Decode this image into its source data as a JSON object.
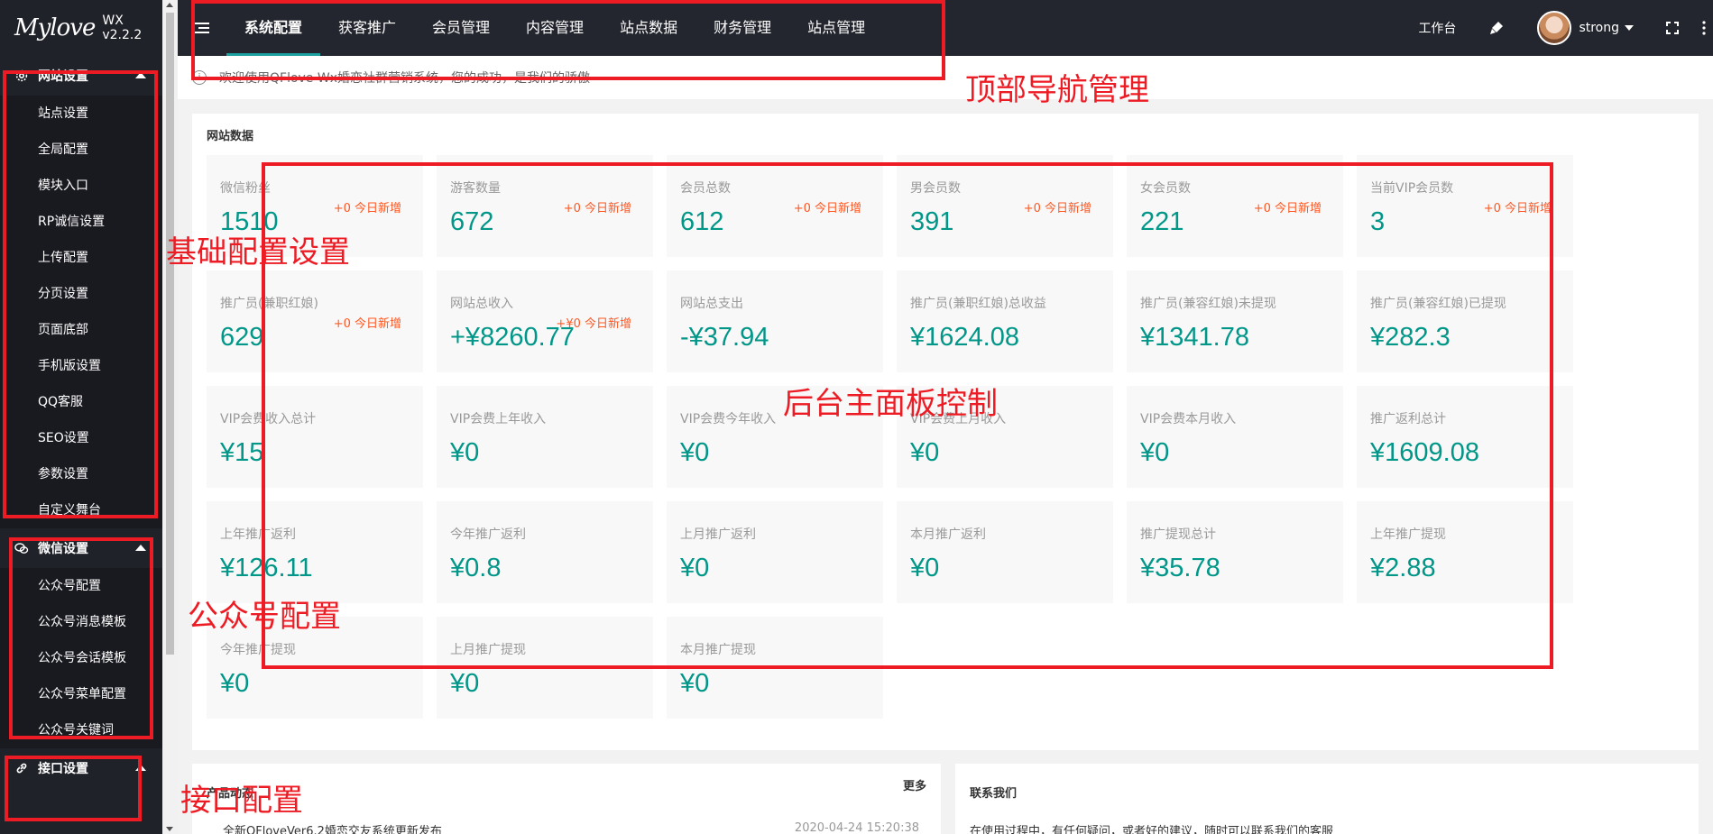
{
  "app": {
    "logo_text": "Mylove",
    "version": "WX v2.2.2"
  },
  "topnav": {
    "tabs": [
      {
        "label": "系统配置",
        "active": true
      },
      {
        "label": "获客推广"
      },
      {
        "label": "会员管理"
      },
      {
        "label": "内容管理"
      },
      {
        "label": "站点数据"
      },
      {
        "label": "财务管理"
      },
      {
        "label": "站点管理"
      }
    ],
    "workbench": "工作台",
    "username": "strong",
    "icons": [
      "menu-toggle-icon",
      "brush-icon",
      "fullscreen-icon",
      "more-icon"
    ]
  },
  "sidebar": {
    "groups": [
      {
        "title": "网站设置",
        "icon": "gear-icon",
        "items": [
          "站点设置",
          "全局配置",
          "模块入口",
          "RP诚信设置",
          "上传配置",
          "分页设置",
          "页面底部",
          "手机版设置",
          "QQ客服",
          "SEO设置",
          "参数设置",
          "自定义舞台"
        ]
      },
      {
        "title": "微信设置",
        "icon": "wechat-icon",
        "items": [
          "公众号配置",
          "公众号消息模板",
          "公众号会话模板",
          "公众号菜单配置",
          "公众号关键词"
        ]
      },
      {
        "title": "接口设置",
        "icon": "link-icon",
        "items": []
      }
    ]
  },
  "notice": {
    "text": "欢迎使用QFlove Wx婚恋社群营销系统，您的成功，是我们的骄傲"
  },
  "panel": {
    "title": "网站数据",
    "cards": [
      {
        "label": "微信粉丝",
        "value": "1510",
        "badge": "+0 今日新增"
      },
      {
        "label": "游客数量",
        "value": "672",
        "badge": "+0 今日新增"
      },
      {
        "label": "会员总数",
        "value": "612",
        "badge": "+0 今日新增"
      },
      {
        "label": "男会员数",
        "value": "391",
        "badge": "+0 今日新增"
      },
      {
        "label": "女会员数",
        "value": "221",
        "badge": "+0 今日新增"
      },
      {
        "label": "当前VIP会员数",
        "value": "3",
        "badge": "+0 今日新增"
      },
      {
        "label": "推广员(兼职红娘)",
        "value": "629",
        "badge": "+0 今日新增"
      },
      {
        "label": "网站总收入",
        "value": "+¥8260.77",
        "badge": "+¥0 今日新增"
      },
      {
        "label": "网站总支出",
        "value": "-¥37.94",
        "badge": ""
      },
      {
        "label": "推广员(兼职红娘)总收益",
        "value": "¥1624.08",
        "badge": ""
      },
      {
        "label": "推广员(兼容红娘)未提现",
        "value": "¥1341.78",
        "badge": ""
      },
      {
        "label": "推广员(兼容红娘)已提现",
        "value": "¥282.3",
        "badge": ""
      },
      {
        "label": "VIP会费收入总计",
        "value": "¥15",
        "badge": ""
      },
      {
        "label": "VIP会费上年收入",
        "value": "¥0",
        "badge": ""
      },
      {
        "label": "VIP会费今年收入",
        "value": "¥0",
        "badge": ""
      },
      {
        "label": "VIP会费上月收入",
        "value": "¥0",
        "badge": ""
      },
      {
        "label": "VIP会费本月收入",
        "value": "¥0",
        "badge": ""
      },
      {
        "label": "推广返利总计",
        "value": "¥1609.08",
        "badge": ""
      },
      {
        "label": "上年推广返利",
        "value": "¥126.11",
        "badge": ""
      },
      {
        "label": "今年推广返利",
        "value": "¥0.8",
        "badge": ""
      },
      {
        "label": "上月推广返利",
        "value": "¥0",
        "badge": ""
      },
      {
        "label": "本月推广返利",
        "value": "¥0",
        "badge": ""
      },
      {
        "label": "推广提现总计",
        "value": "¥35.78",
        "badge": ""
      },
      {
        "label": "上年推广提现",
        "value": "¥2.88",
        "badge": ""
      },
      {
        "label": "今年推广提现",
        "value": "¥0",
        "badge": ""
      },
      {
        "label": "上月推广提现",
        "value": "¥0",
        "badge": ""
      },
      {
        "label": "本月推广提现",
        "value": "¥0",
        "badge": ""
      }
    ]
  },
  "news": {
    "title": "产品动态",
    "more": "更多",
    "item": "全新QFloveVer6.2婚恋交友系统更新发布",
    "date": "2020-04-24 15:20:38"
  },
  "contact": {
    "title": "联系我们",
    "text": "在使用过程中，有任何疑问，或者好的建议，随时可以联系我们的客服"
  },
  "annotations": {
    "top_nav": "顶部导航管理",
    "basic_config": "基础配置设置",
    "main_panel": "后台主面板控制",
    "wechat_config": "公众号配置",
    "api_config": "接口配置"
  },
  "colors": {
    "accent": "#009688",
    "badge": "#ff5722",
    "annotation": "#ed1c24",
    "topbar": "#23262e",
    "sidebar": "#20222a"
  }
}
